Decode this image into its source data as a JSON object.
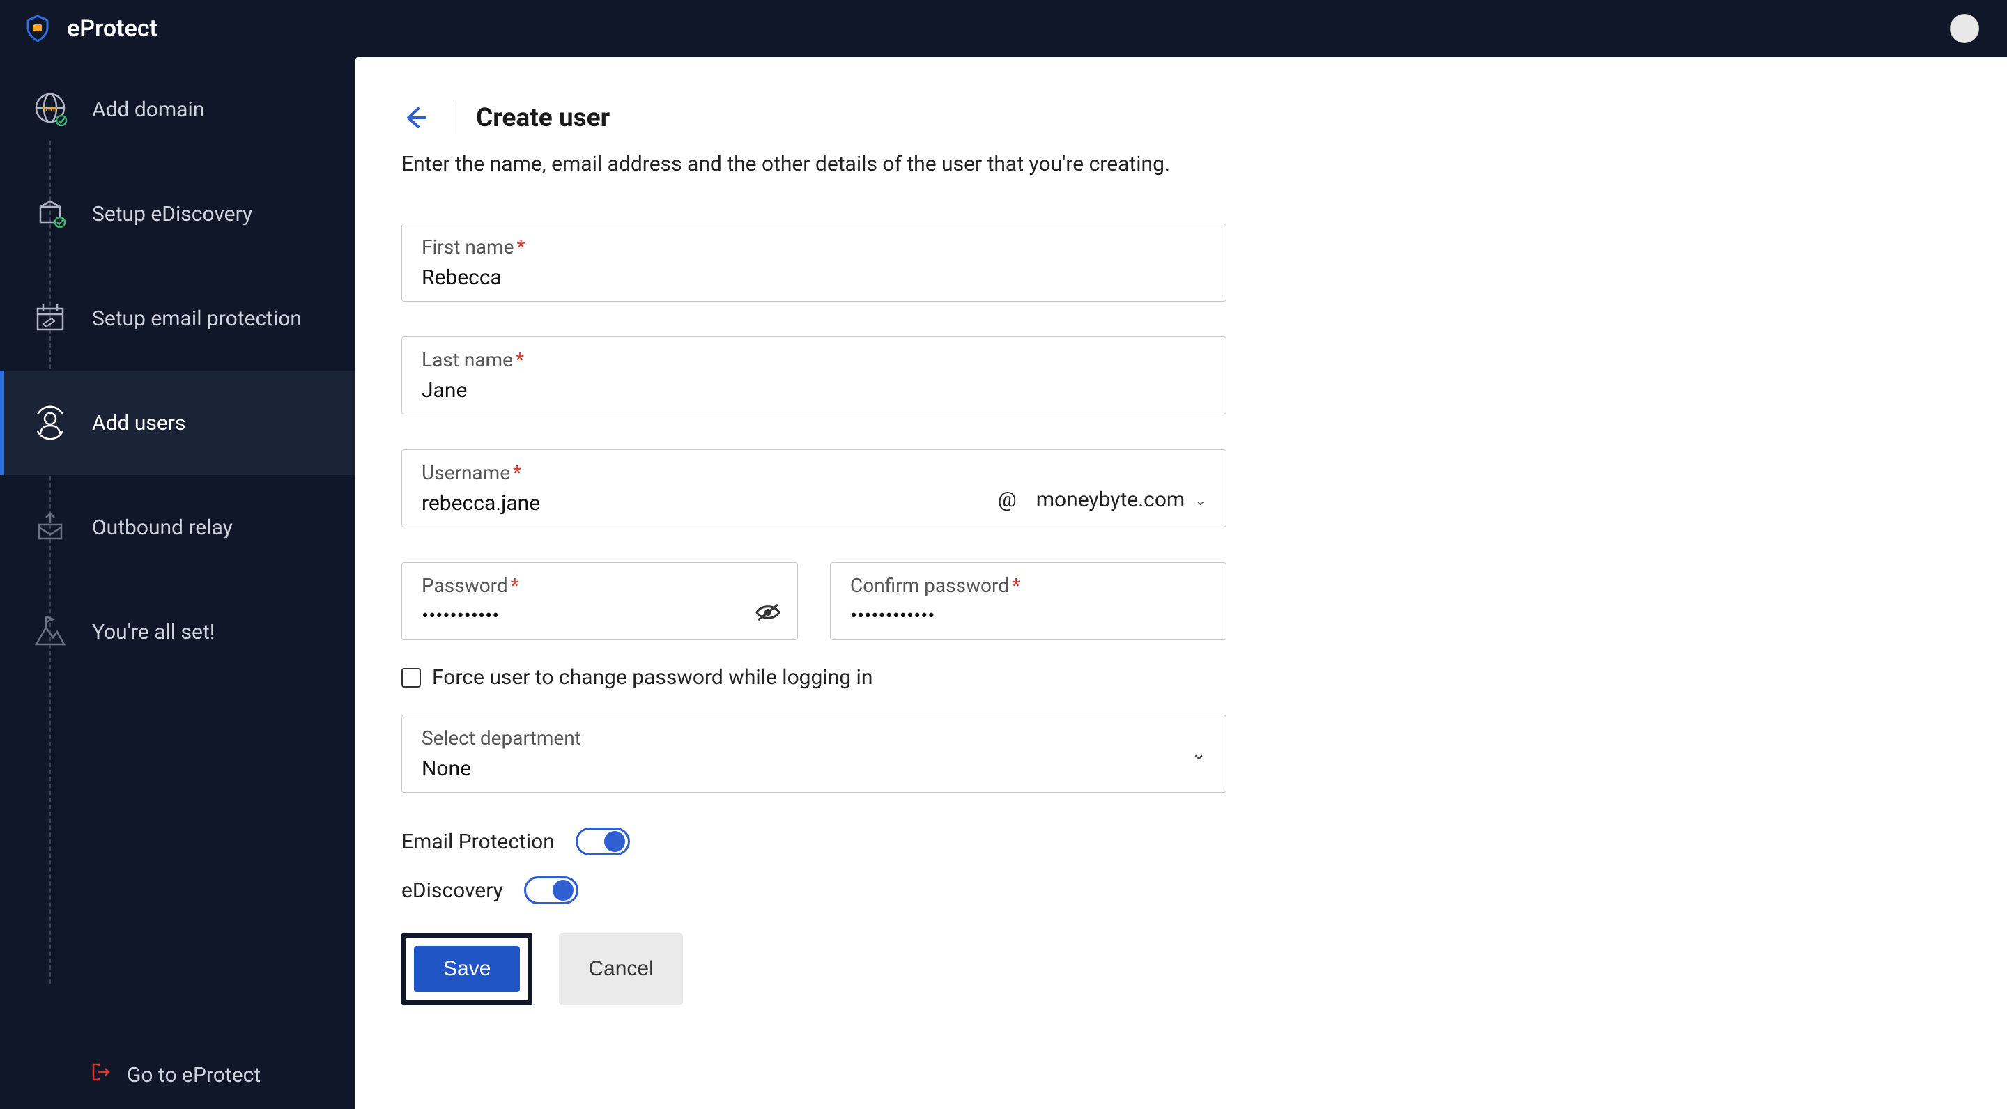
{
  "brand": {
    "name": "eProtect"
  },
  "sidebar": {
    "items": [
      {
        "label": "Add domain"
      },
      {
        "label": "Setup eDiscovery"
      },
      {
        "label": "Setup email protection"
      },
      {
        "label": "Add users"
      },
      {
        "label": "Outbound relay"
      },
      {
        "label": "You're all set!"
      }
    ],
    "footer": {
      "label": "Go to eProtect"
    }
  },
  "main": {
    "title": "Create user",
    "subtitle": "Enter the name, email address and the other details of the user that you're creating.",
    "fields": {
      "first_name": {
        "label": "First name",
        "value": "Rebecca"
      },
      "last_name": {
        "label": "Last name",
        "value": "Jane"
      },
      "username": {
        "label": "Username",
        "value": "rebecca.jane",
        "at": "@",
        "domain": "moneybyte.com"
      },
      "password": {
        "label": "Password",
        "value": "•••••••••••"
      },
      "confirm_password": {
        "label": "Confirm password",
        "value": "••••••••••••"
      },
      "force_change": {
        "label": "Force user to change password while logging in",
        "checked": false
      },
      "department": {
        "label": "Select department",
        "value": "None"
      }
    },
    "toggles": {
      "email_protection": {
        "label": "Email Protection",
        "on": true
      },
      "ediscovery": {
        "label": "eDiscovery",
        "on": true
      }
    },
    "buttons": {
      "save": "Save",
      "cancel": "Cancel"
    }
  }
}
